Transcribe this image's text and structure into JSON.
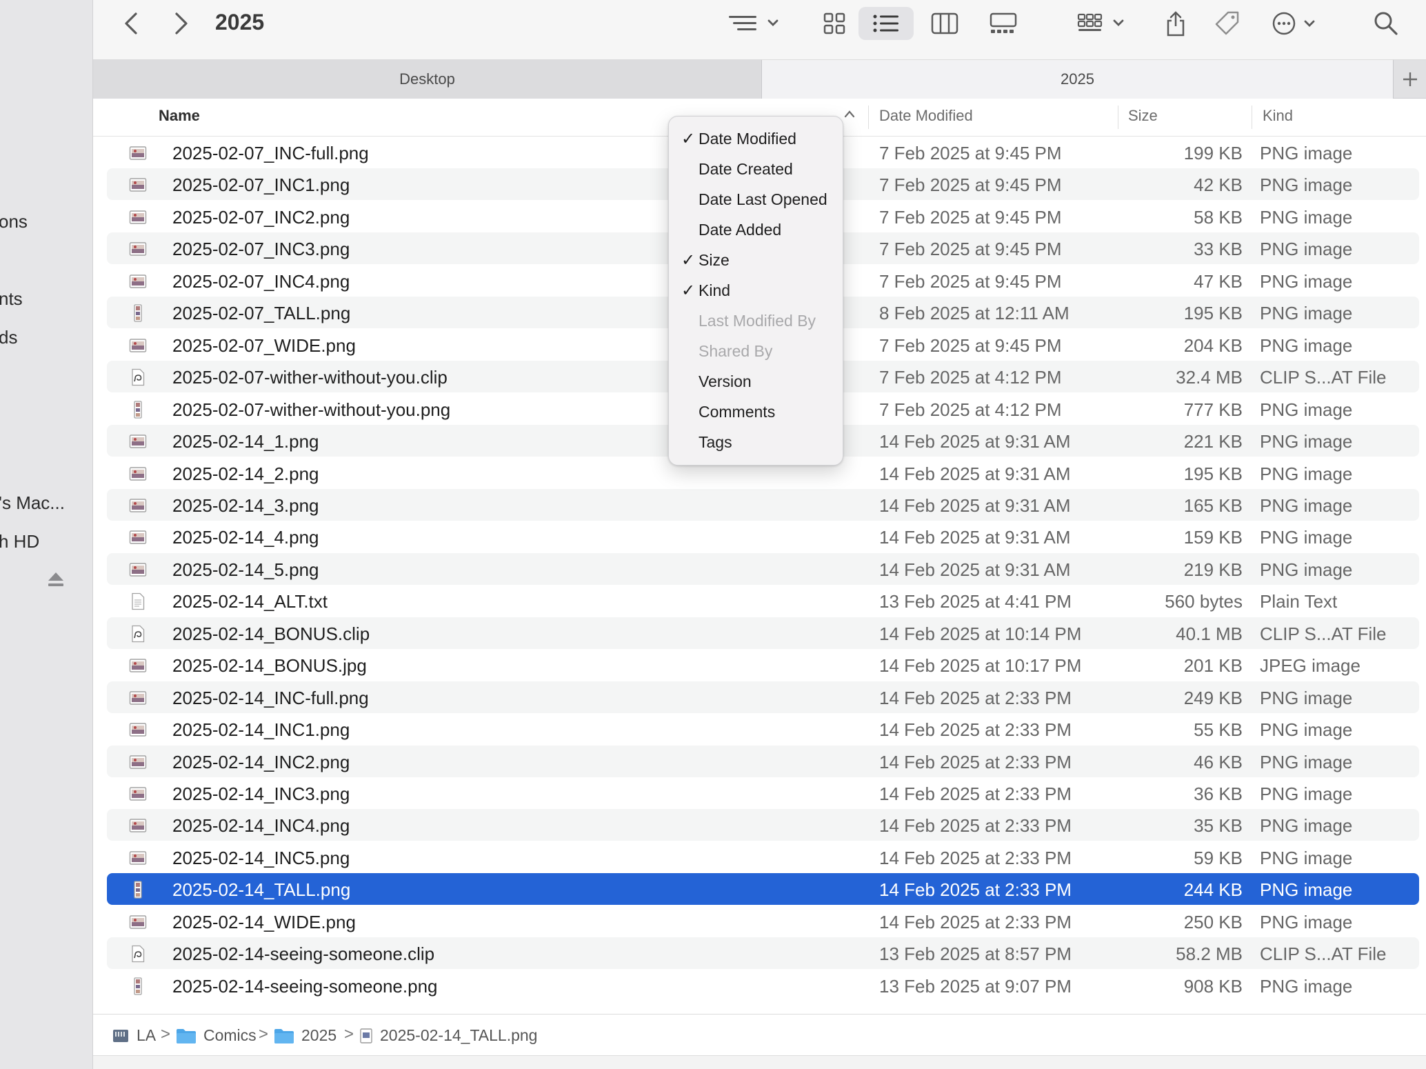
{
  "window": {
    "title": "2025"
  },
  "sidebar": {
    "items": [
      "ons",
      "nts",
      "ds",
      "'s Mac...",
      "h HD"
    ]
  },
  "tabs": [
    {
      "label": "Desktop",
      "active": false
    },
    {
      "label": "2025",
      "active": true
    }
  ],
  "columns": {
    "name": "Name",
    "date": "Date Modified",
    "size": "Size",
    "kind": "Kind"
  },
  "menu": {
    "items": [
      {
        "label": "Date Modified",
        "checked": true,
        "enabled": true
      },
      {
        "label": "Date Created",
        "checked": false,
        "enabled": true
      },
      {
        "label": "Date Last Opened",
        "checked": false,
        "enabled": true
      },
      {
        "label": "Date Added",
        "checked": false,
        "enabled": true
      },
      {
        "label": "Size",
        "checked": true,
        "enabled": true
      },
      {
        "label": "Kind",
        "checked": true,
        "enabled": true
      },
      {
        "label": "Last Modified By",
        "checked": false,
        "enabled": false
      },
      {
        "label": "Shared By",
        "checked": false,
        "enabled": false
      },
      {
        "label": "Version",
        "checked": false,
        "enabled": true
      },
      {
        "label": "Comments",
        "checked": false,
        "enabled": true
      },
      {
        "label": "Tags",
        "checked": false,
        "enabled": true
      }
    ],
    "check_glyph": "✓"
  },
  "files": [
    {
      "name": "2025-02-07_INC-full.png",
      "date": "7 Feb 2025 at 9:45 PM",
      "size": "199 KB",
      "kind": "PNG image",
      "icon": "image-icon"
    },
    {
      "name": "2025-02-07_INC1.png",
      "date": "7 Feb 2025 at 9:45 PM",
      "size": "42 KB",
      "kind": "PNG image",
      "icon": "image-icon"
    },
    {
      "name": "2025-02-07_INC2.png",
      "date": "7 Feb 2025 at 9:45 PM",
      "size": "58 KB",
      "kind": "PNG image",
      "icon": "image-icon"
    },
    {
      "name": "2025-02-07_INC3.png",
      "date": "7 Feb 2025 at 9:45 PM",
      "size": "33 KB",
      "kind": "PNG image",
      "icon": "image-icon"
    },
    {
      "name": "2025-02-07_INC4.png",
      "date": "7 Feb 2025 at 9:45 PM",
      "size": "47 KB",
      "kind": "PNG image",
      "icon": "image-icon"
    },
    {
      "name": "2025-02-07_TALL.png",
      "date": "8 Feb 2025 at 12:11 AM",
      "size": "195 KB",
      "kind": "PNG image",
      "icon": "tall-image-icon"
    },
    {
      "name": "2025-02-07_WIDE.png",
      "date": "7 Feb 2025 at 9:45 PM",
      "size": "204 KB",
      "kind": "PNG image",
      "icon": "image-icon"
    },
    {
      "name": "2025-02-07-wither-without-you.clip",
      "date": "7 Feb 2025 at 4:12 PM",
      "size": "32.4 MB",
      "kind": "CLIP S...AT File",
      "icon": "clip-file-icon"
    },
    {
      "name": "2025-02-07-wither-without-you.png",
      "date": "7 Feb 2025 at 4:12 PM",
      "size": "777 KB",
      "kind": "PNG image",
      "icon": "tall-image-icon"
    },
    {
      "name": "2025-02-14_1.png",
      "date": "14 Feb 2025 at 9:31 AM",
      "size": "221 KB",
      "kind": "PNG image",
      "icon": "image-icon"
    },
    {
      "name": "2025-02-14_2.png",
      "date": "14 Feb 2025 at 9:31 AM",
      "size": "195 KB",
      "kind": "PNG image",
      "icon": "image-icon"
    },
    {
      "name": "2025-02-14_3.png",
      "date": "14 Feb 2025 at 9:31 AM",
      "size": "165 KB",
      "kind": "PNG image",
      "icon": "image-icon"
    },
    {
      "name": "2025-02-14_4.png",
      "date": "14 Feb 2025 at 9:31 AM",
      "size": "159 KB",
      "kind": "PNG image",
      "icon": "image-icon"
    },
    {
      "name": "2025-02-14_5.png",
      "date": "14 Feb 2025 at 9:31 AM",
      "size": "219 KB",
      "kind": "PNG image",
      "icon": "image-icon"
    },
    {
      "name": "2025-02-14_ALT.txt",
      "date": "13 Feb 2025 at 4:41 PM",
      "size": "560 bytes",
      "kind": "Plain Text",
      "icon": "text-file-icon"
    },
    {
      "name": "2025-02-14_BONUS.clip",
      "date": "14 Feb 2025 at 10:14 PM",
      "size": "40.1 MB",
      "kind": "CLIP S...AT File",
      "icon": "clip-file-icon"
    },
    {
      "name": "2025-02-14_BONUS.jpg",
      "date": "14 Feb 2025 at 10:17 PM",
      "size": "201 KB",
      "kind": "JPEG image",
      "icon": "image-icon"
    },
    {
      "name": "2025-02-14_INC-full.png",
      "date": "14 Feb 2025 at 2:33 PM",
      "size": "249 KB",
      "kind": "PNG image",
      "icon": "image-icon"
    },
    {
      "name": "2025-02-14_INC1.png",
      "date": "14 Feb 2025 at 2:33 PM",
      "size": "55 KB",
      "kind": "PNG image",
      "icon": "image-icon"
    },
    {
      "name": "2025-02-14_INC2.png",
      "date": "14 Feb 2025 at 2:33 PM",
      "size": "46 KB",
      "kind": "PNG image",
      "icon": "image-icon"
    },
    {
      "name": "2025-02-14_INC3.png",
      "date": "14 Feb 2025 at 2:33 PM",
      "size": "36 KB",
      "kind": "PNG image",
      "icon": "image-icon"
    },
    {
      "name": "2025-02-14_INC4.png",
      "date": "14 Feb 2025 at 2:33 PM",
      "size": "35 KB",
      "kind": "PNG image",
      "icon": "image-icon"
    },
    {
      "name": "2025-02-14_INC5.png",
      "date": "14 Feb 2025 at 2:33 PM",
      "size": "59 KB",
      "kind": "PNG image",
      "icon": "image-icon"
    },
    {
      "name": "2025-02-14_TALL.png",
      "date": "14 Feb 2025 at 2:33 PM",
      "size": "244 KB",
      "kind": "PNG image",
      "icon": "tall-image-icon",
      "selected": true
    },
    {
      "name": "2025-02-14_WIDE.png",
      "date": "14 Feb 2025 at 2:33 PM",
      "size": "250 KB",
      "kind": "PNG image",
      "icon": "image-icon"
    },
    {
      "name": "2025-02-14-seeing-someone.clip",
      "date": "13 Feb 2025 at 8:57 PM",
      "size": "58.2 MB",
      "kind": "CLIP S...AT File",
      "icon": "clip-file-icon"
    },
    {
      "name": "2025-02-14-seeing-someone.png",
      "date": "13 Feb 2025 at 9:07 PM",
      "size": "908 KB",
      "kind": "PNG image",
      "icon": "tall-image-icon"
    }
  ],
  "pathbar": {
    "items": [
      {
        "label": "LA",
        "icon": "drive-icon"
      },
      {
        "label": "Comics",
        "icon": "folder-icon"
      },
      {
        "label": "2025",
        "icon": "folder-icon"
      },
      {
        "label": "2025-02-14_TALL.png",
        "icon": "image-file-icon"
      }
    ],
    "separator": ">"
  },
  "colors": {
    "selection": "#2463d6",
    "sidebar_bg": "#e6e6e8",
    "row_alt": "#f4f5f5"
  }
}
